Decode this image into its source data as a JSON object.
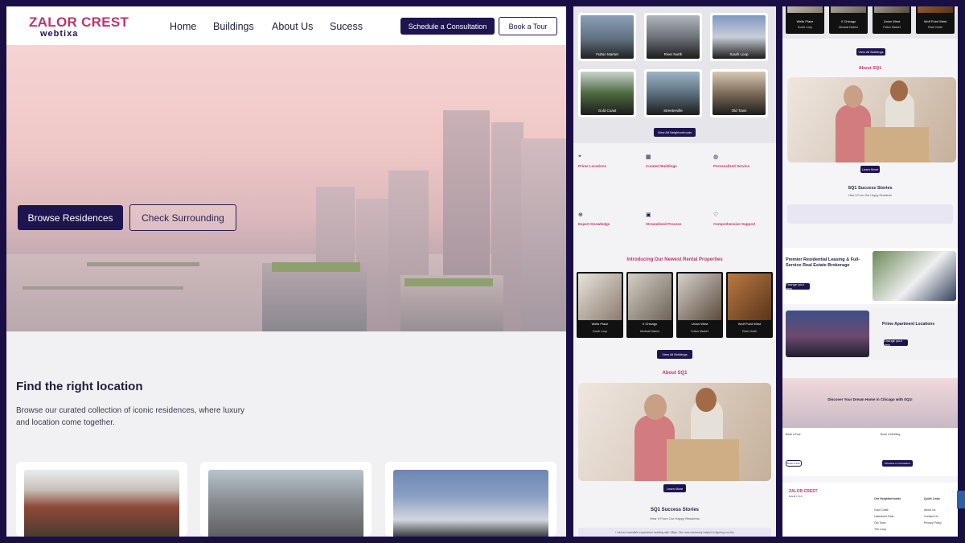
{
  "main": {
    "logo": {
      "top": "ZALOR CREST",
      "bottom": "webtixa"
    },
    "nav": [
      "Home",
      "Buildings",
      "About Us",
      "Sucess"
    ],
    "schedule_button": "Schedule a Consultation",
    "tour_button": "Book a Tour",
    "hero_buttons": {
      "browse": "Browse Residences",
      "surrounding": "Check Surrounding"
    },
    "section_title": "Find the right location",
    "section_desc": "Browse our curated collection of iconic residences, where luxury and location come together."
  },
  "middle": {
    "neighborhoods": [
      "Fulton Market",
      "River North",
      "South Loop",
      "Gold Coast",
      "Streeterville",
      "Old Town"
    ],
    "view_neighborhoods": "View All Neighborhoods",
    "features": [
      {
        "icon": "pin",
        "title": "Prime Locations"
      },
      {
        "icon": "building",
        "title": "Curated Buildings"
      },
      {
        "icon": "bulb",
        "title": "Personalized Service"
      },
      {
        "icon": "globe",
        "title": "Expert Knowledge"
      },
      {
        "icon": "process",
        "title": "Streamlined Process"
      },
      {
        "icon": "heart",
        "title": "Comprehensive Support"
      }
    ],
    "properties_heading": "Introducing Our Newest Rental Properties",
    "properties": [
      {
        "name": "Wells Place",
        "loc": "South Loop"
      },
      {
        "name": "X Chicago",
        "loc": "Medical District"
      },
      {
        "name": "Union West",
        "loc": "Fulton Market"
      },
      {
        "name": "Wolf Point West",
        "loc": "River North"
      }
    ],
    "view_buildings": "View All Buildings",
    "about_heading": "About SQ1",
    "learn_more": "Learn More",
    "stories_title": "SQ1 Success Stories",
    "stories_sub": "Hear It From Our Happy Residents",
    "testimonial": "I had an incredible experience working with Jillian. She was extremely helpful in figuring out the"
  },
  "right": {
    "top_props": [
      {
        "name": "Wells Place",
        "loc": "South Loop"
      },
      {
        "name": "X Chicago",
        "loc": "Medical District"
      },
      {
        "name": "Union West",
        "loc": "Fulton Market"
      },
      {
        "name": "Wolf Point West",
        "loc": "River North"
      }
    ],
    "view_buildings": "View All Buildings",
    "about_heading": "About SQ1",
    "learn_more": "Learn More",
    "stories_title": "SQ1 Success Stories",
    "stories_sub": "Hear It From Our Happy Residents",
    "leasing_title": "Premier Residential Leasing & Full-Service Real Estate Brokerage",
    "leasing_btn": "Change your view",
    "prime_title": "Prime Apartment Locations",
    "prime_btn": "Change your view",
    "dream_title": "Discover Your Dream Home in Chicago with SQ1!",
    "book_tour_label": "Book a Tour",
    "book_meeting_label": "Book a Meeting",
    "book_tour_btn": "Book a Tour",
    "schedule_btn": "Schedule a Consultation",
    "footer": {
      "logo_top": "ZALOR CREST",
      "logo_bottom": "WEBTIXA",
      "col1_title": "Our Neighborhoods",
      "col1": [
        "Gold Coast",
        "Lakeshore East",
        "Old Town",
        "The Loop"
      ],
      "col2_title": "Quick Links",
      "col2": [
        "About Us",
        "Contact Us",
        "Privacy Policy"
      ]
    }
  }
}
